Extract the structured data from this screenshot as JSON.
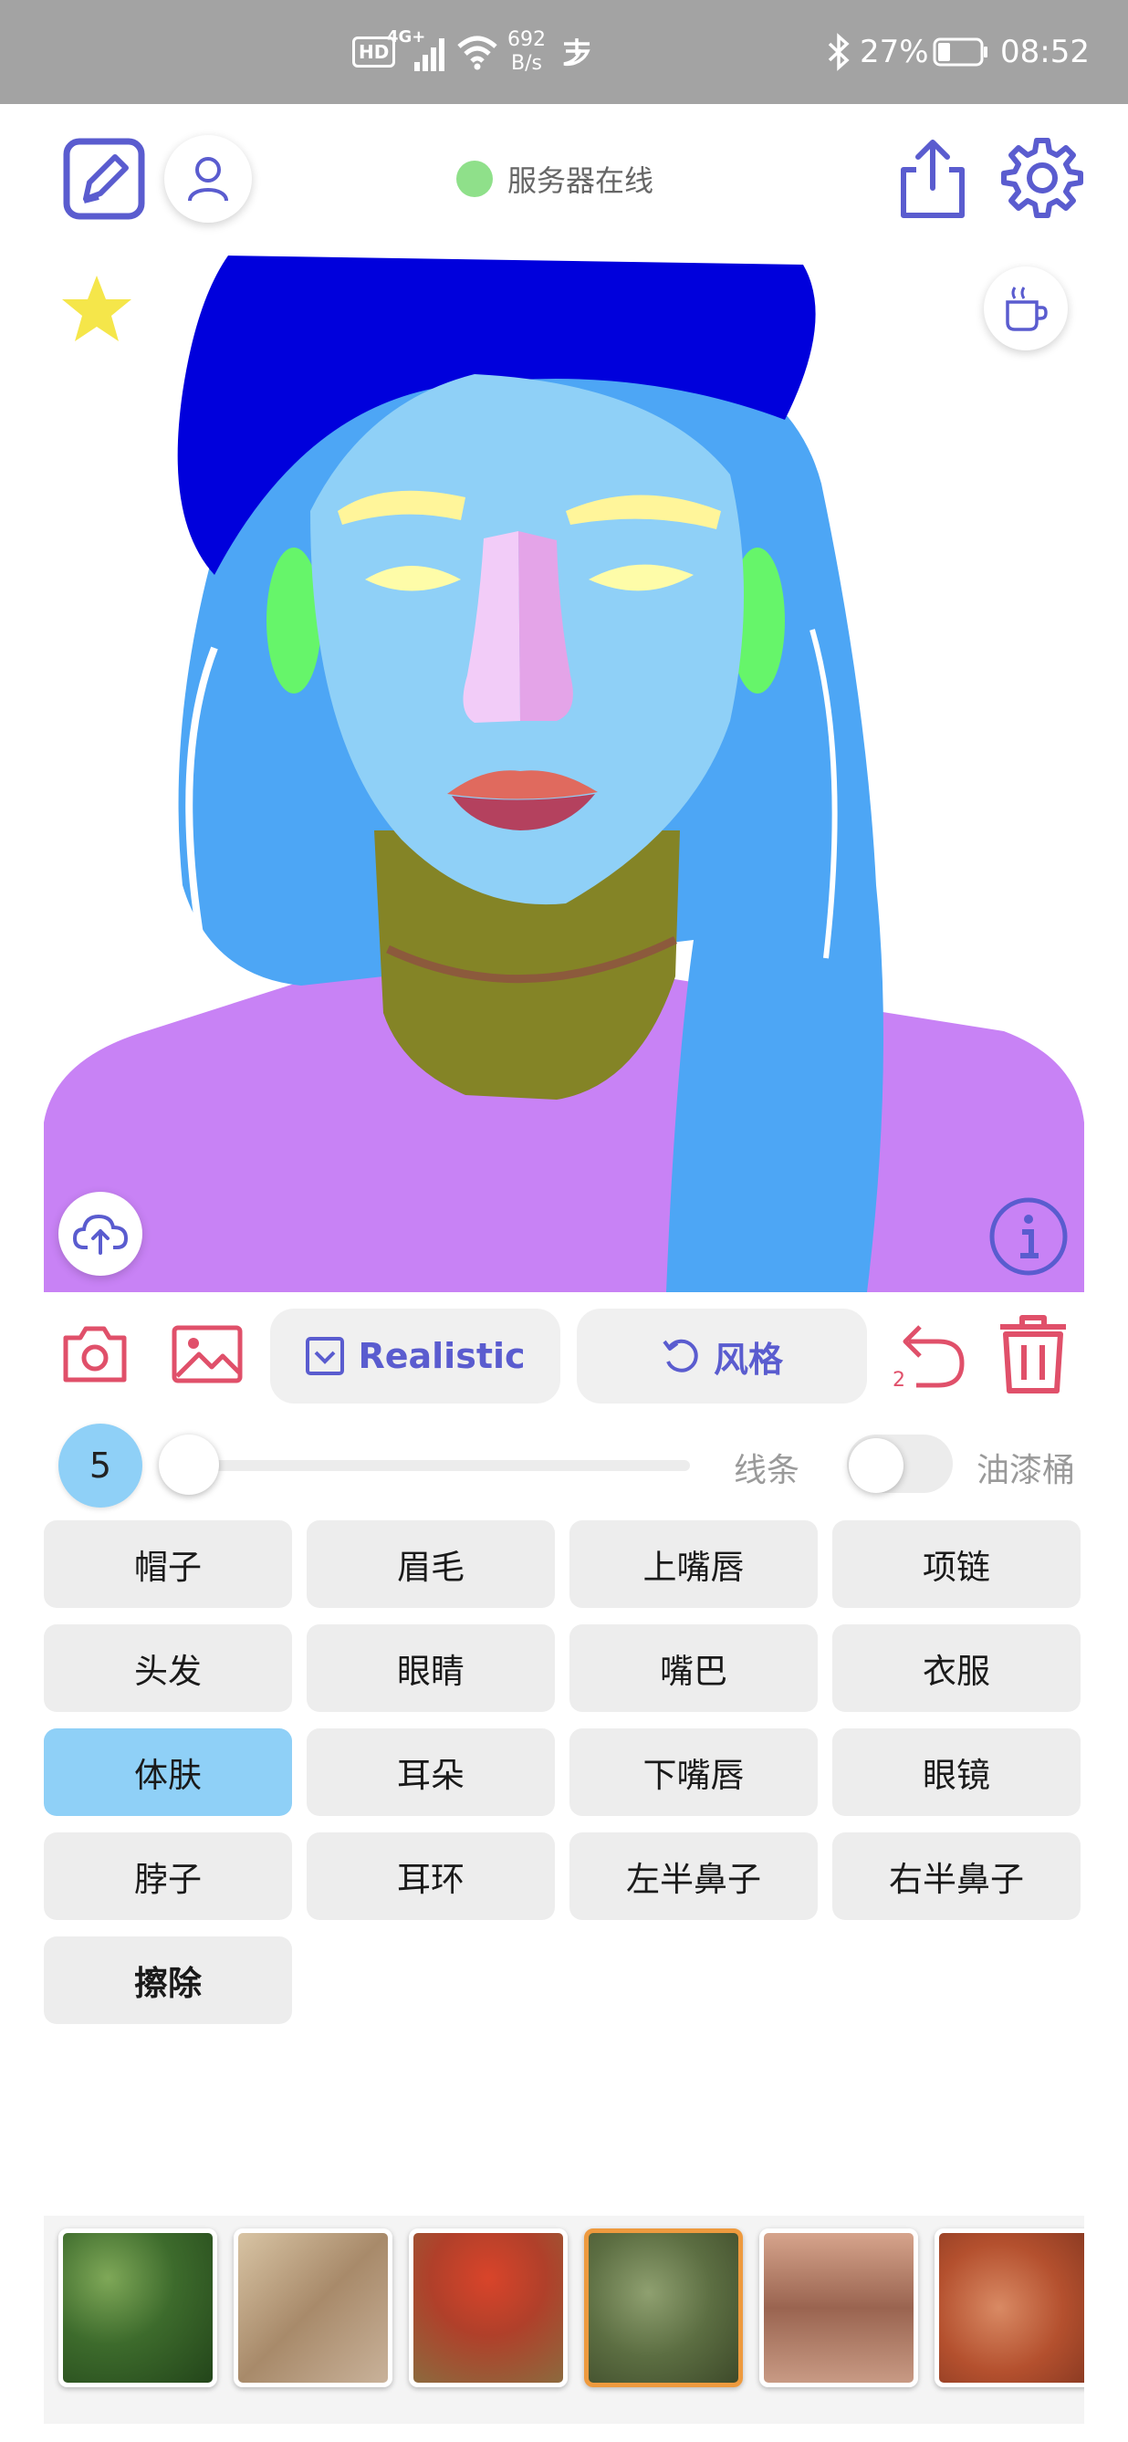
{
  "status_bar": {
    "hd": "HD",
    "network": "4G+",
    "net_speed_value": "692",
    "net_speed_unit": "B/s",
    "battery": "27%",
    "time": "08:52"
  },
  "header": {
    "server_status": "服务器在线",
    "server_status_color": "#8fe08a"
  },
  "toolbar": {
    "model_label": "Realistic",
    "style_label": "风格",
    "undo_count": "2"
  },
  "brush": {
    "size": "5",
    "line_label": "线条",
    "bucket_label": "油漆桶"
  },
  "parts": [
    {
      "label": "帽子",
      "color": "#0000dc"
    },
    {
      "label": "眉毛",
      "color": "#fff59a"
    },
    {
      "label": "上嘴唇",
      "color": "#e06a5e"
    },
    {
      "label": "项链",
      "color": "#8c5a3c"
    },
    {
      "label": "头发",
      "color": "#4da6f5"
    },
    {
      "label": "眼睛",
      "color": "#fefca8"
    },
    {
      "label": "嘴巴",
      "color": "#9c4a58"
    },
    {
      "label": "衣服",
      "color": "#c882f5"
    },
    {
      "label": "体肤",
      "color": "#8fd0f7",
      "selected": true
    },
    {
      "label": "耳朵",
      "color": "#66f56a"
    },
    {
      "label": "下嘴唇",
      "color": "#b4415e"
    },
    {
      "label": "眼镜",
      "color": "#ededed"
    },
    {
      "label": "脖子",
      "color": "#848426"
    },
    {
      "label": "耳环",
      "color": "#ededed"
    },
    {
      "label": "左半鼻子",
      "color": "#f2ccf8"
    },
    {
      "label": "右半鼻子",
      "color": "#e4a4e8"
    },
    {
      "label": "擦除",
      "color": "#ffffff"
    }
  ],
  "textures": [
    {
      "name": "green-foliage",
      "selected": false
    },
    {
      "name": "beige-fabric",
      "selected": false
    },
    {
      "name": "red-flowers",
      "selected": false
    },
    {
      "name": "moss-green",
      "selected": true
    },
    {
      "name": "blurred-skin",
      "selected": false
    },
    {
      "name": "orange-skin",
      "selected": false
    }
  ],
  "colors": {
    "accent": "#5a5ccf",
    "danger": "#e0506a",
    "selected_part": "#8fd0f7",
    "selected_texture": "#ee9a3e"
  }
}
